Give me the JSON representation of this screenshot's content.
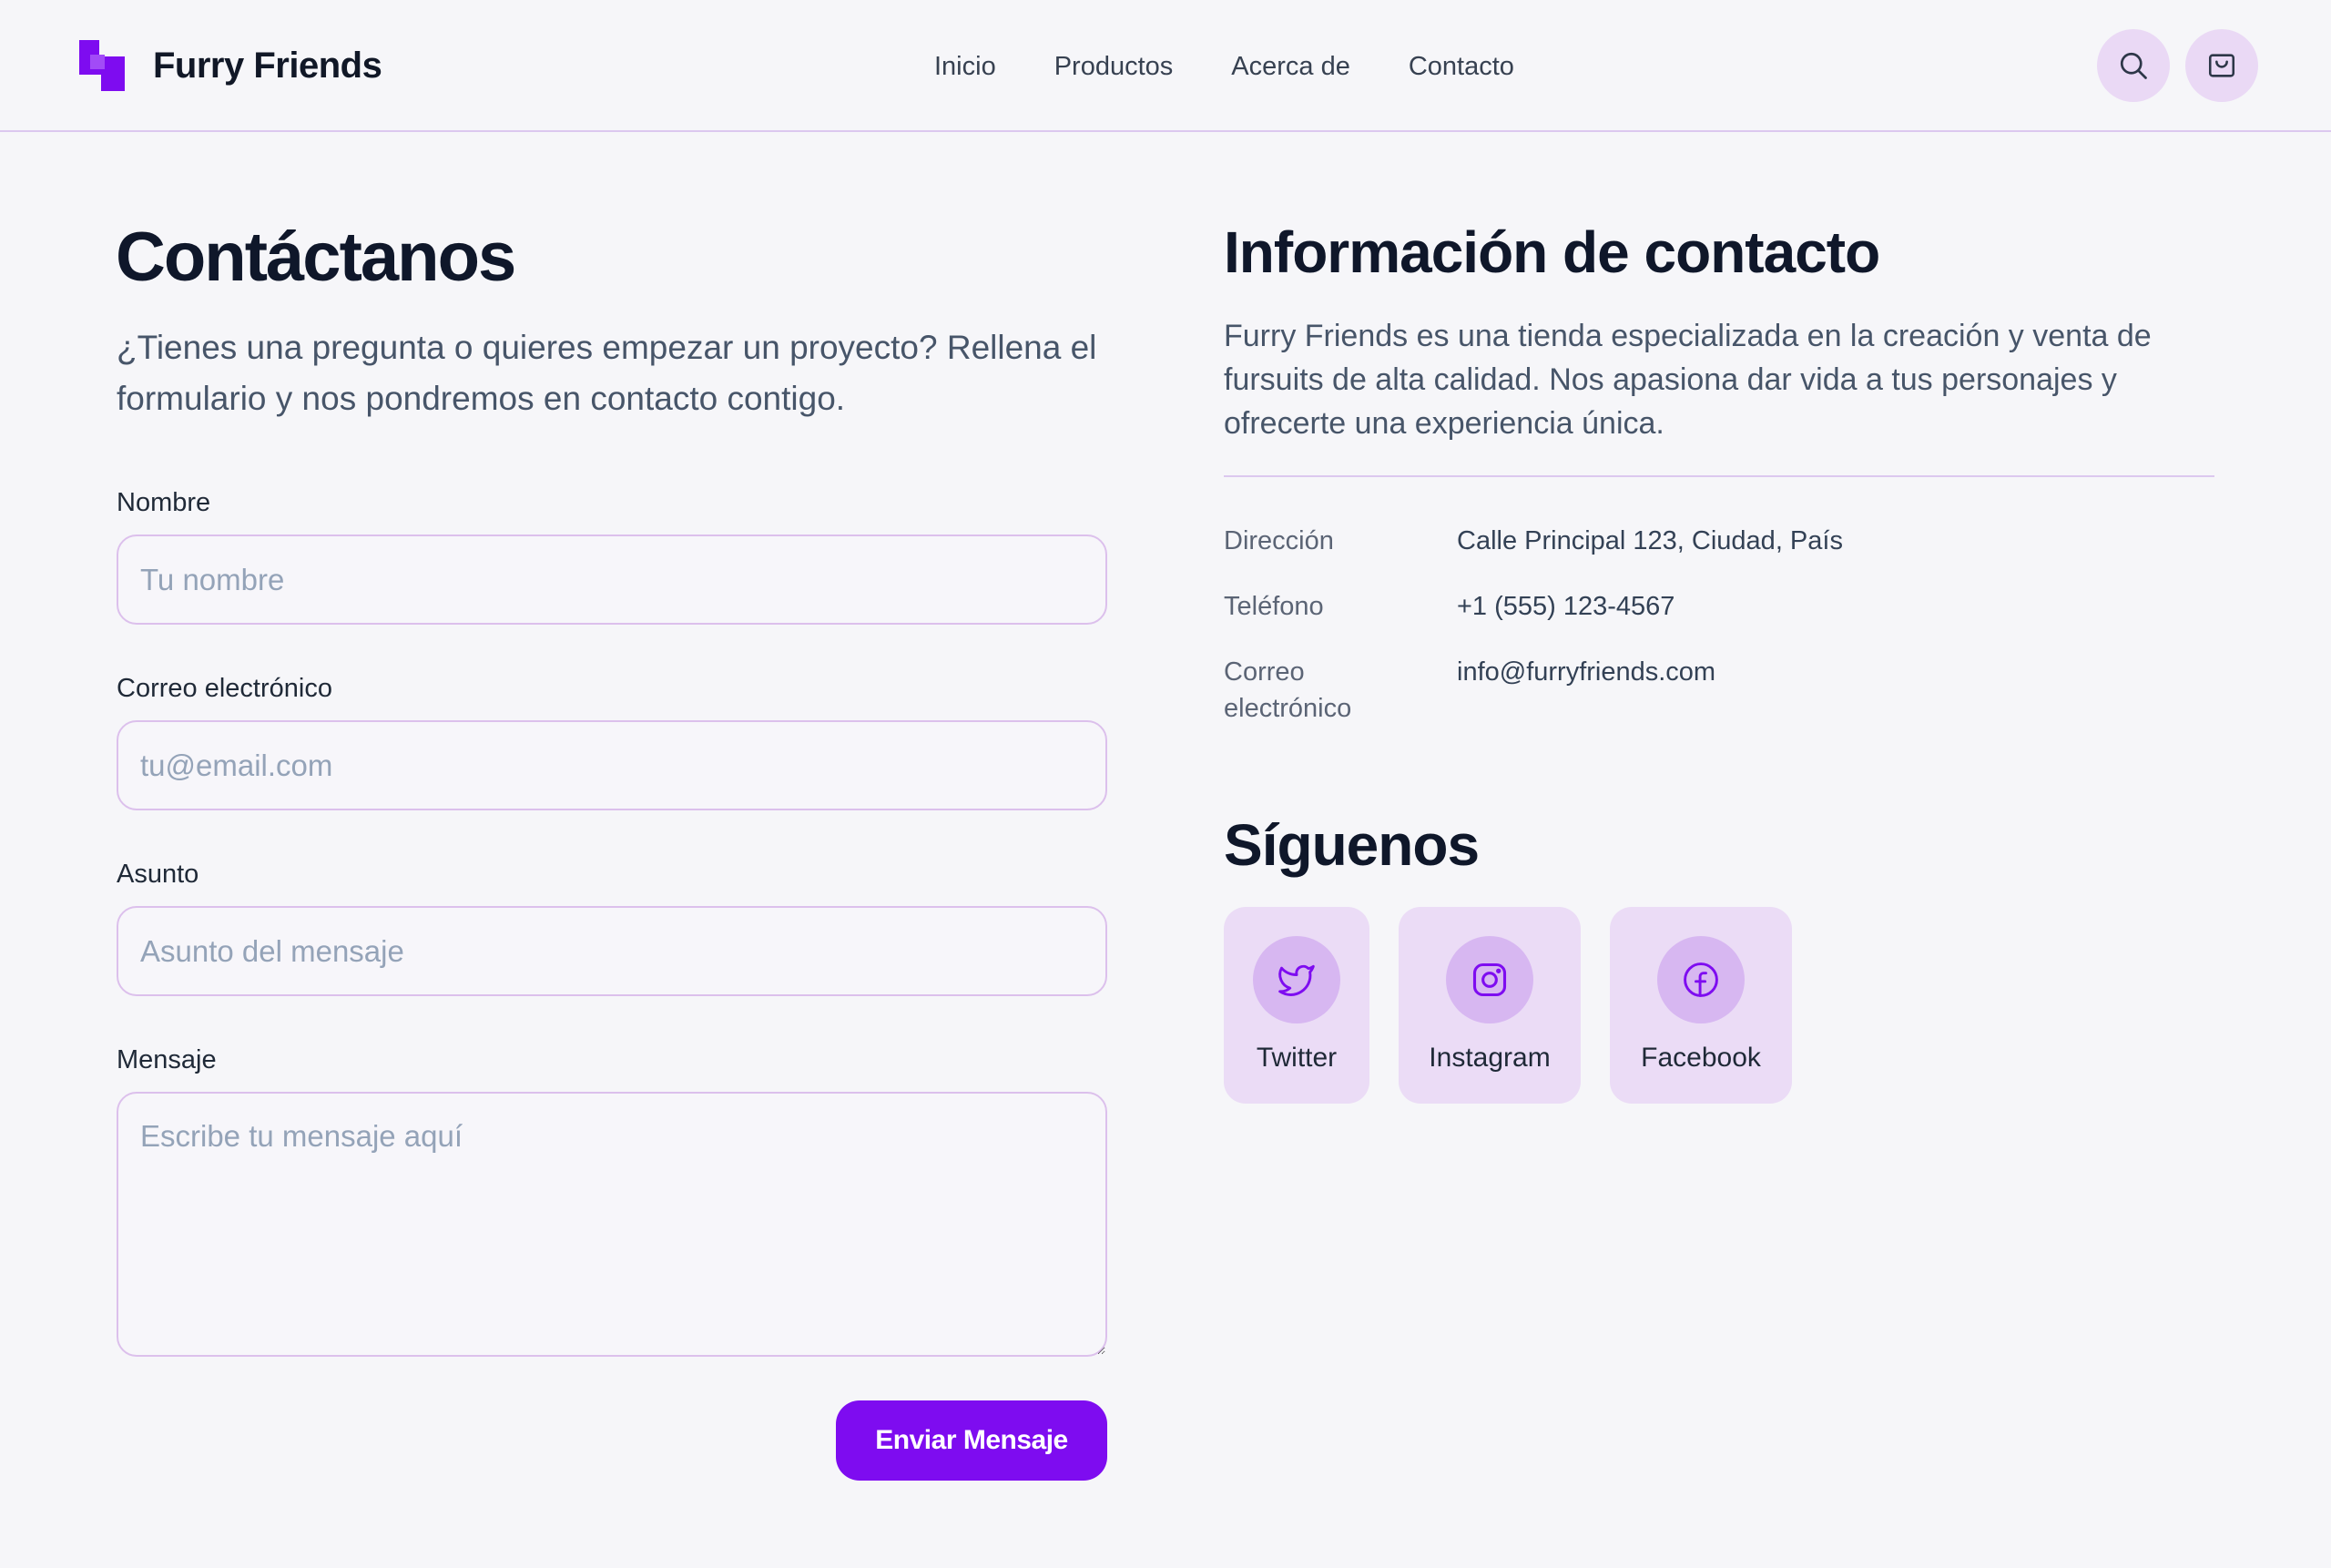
{
  "header": {
    "brand": "Furry Friends",
    "logo_icon": "brand-logo-icon",
    "nav": [
      {
        "label": "Inicio"
      },
      {
        "label": "Productos"
      },
      {
        "label": "Acerca de"
      },
      {
        "label": "Contacto"
      }
    ],
    "search_icon": "search-icon",
    "cart_icon": "shopping-bag-icon"
  },
  "form": {
    "title": "Contáctanos",
    "subtitle": "¿Tienes una pregunta o quieres empezar un proyecto? Rellena el formulario y nos pondremos en contacto contigo.",
    "fields": {
      "name": {
        "label": "Nombre",
        "placeholder": "Tu nombre",
        "value": ""
      },
      "email": {
        "label": "Correo electrónico",
        "placeholder": "tu@email.com",
        "value": ""
      },
      "subject": {
        "label": "Asunto",
        "placeholder": "Asunto del mensaje",
        "value": ""
      },
      "message": {
        "label": "Mensaje",
        "placeholder": "Escribe tu mensaje aquí",
        "value": ""
      }
    },
    "submit_label": "Enviar Mensaje"
  },
  "info": {
    "title": "Información de contacto",
    "description": "Furry Friends es una tienda especializada en la creación y venta de fursuits de alta calidad. Nos apasiona dar vida a tus personajes y ofrecerte una experiencia única.",
    "rows": [
      {
        "key": "Dirección",
        "value": "Calle Principal 123, Ciudad, País"
      },
      {
        "key": "Teléfono",
        "value": "+1 (555) 123-4567"
      },
      {
        "key": "Correo electrónico",
        "value": "info@furryfriends.com"
      }
    ]
  },
  "social": {
    "title": "Síguenos",
    "items": [
      {
        "label": "Twitter",
        "icon": "twitter-icon"
      },
      {
        "label": "Instagram",
        "icon": "instagram-icon"
      },
      {
        "label": "Facebook",
        "icon": "facebook-icon"
      }
    ]
  },
  "colors": {
    "accent": "#7e0cf0",
    "background": "#f6f6f9",
    "border": "#dcc0ec",
    "chip": "#ebdcf6"
  }
}
